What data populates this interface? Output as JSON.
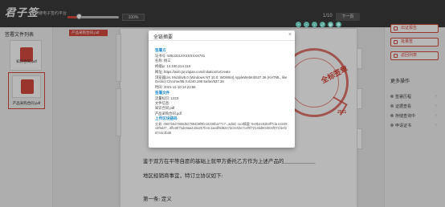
{
  "app": {
    "logo": "君子签",
    "subtitle": "区块链电子签约平台",
    "zoom": "100%",
    "page_indicator": "1/10",
    "next_label": "下一页"
  },
  "left_panel": {
    "title": "签署文件列表",
    "files": [
      {
        "label": "知识合同.pdf"
      },
      {
        "label": "产品采购合同.pdf"
      }
    ]
  },
  "document": {
    "file_tag": "产品采购合同.pdf",
    "seal_text": "全标签章",
    "sig_year": "2021",
    "body_line_1": "鉴于双方在平等自愿的基础上就甲方委托乙方作为上述产品的____________",
    "body_line_2": "地区经销商事宜，特订立协议如下:",
    "chapter": "第一条: 定义"
  },
  "right_panel": {
    "buttons": [
      "出证报告",
      "批量签",
      "返回列表"
    ],
    "more_title": "更多操作",
    "items": [
      "签署历程",
      "证据查看",
      "存储查询中",
      "申请证书"
    ]
  },
  "dialog": {
    "title": "全链摘要",
    "close": "×",
    "section_signer": "签署方",
    "cert_no": "证书号: 5052201XXXXXXXX781",
    "name": "名称: 杨三",
    "ip": "终端ip: 14.100.214.118",
    "url": "网址: https://web.junziqian.com/initiation/toCreate",
    "ua": "浏览器UA: Mozilla/5.0 (Windows NT 10.0; WOW64) AppleWebKit/537.36 (KHTML, like Gecko) Chrome/86.0.4240.198 Safari/537.36",
    "time": "时间: 2021-11-10 14:23:56",
    "section_file": "签署文件",
    "doc_no": "流量标识: 1223",
    "doc_info": "文件信息:",
    "doc_name_1": "知识合同.pdf",
    "doc_name_2": "产品采购合同.pdf",
    "section_chain": "上传区块链码",
    "hash": "交易: 4997b5d7808d527994b9f9fe16338ba7717...ad0d; root摘要: 5e0b4e0d04ff7da e2e09cbf9d47...4fb48f7bde8aa442a257fe4c1aedf9d8267dc0c62e7cef9f72145d904004f071f4ef2d744c3bd8"
  },
  "colors": {
    "accent": "#d64a3f",
    "link": "#1d8bd0",
    "tool": "#5aa89b"
  }
}
